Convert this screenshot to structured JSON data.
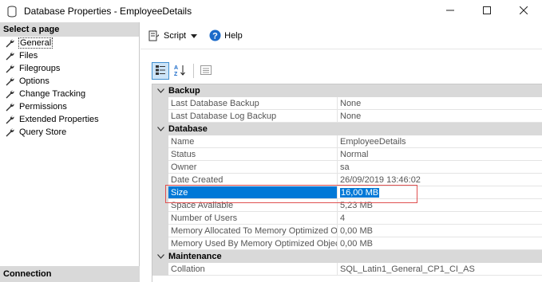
{
  "window": {
    "title": "Database Properties - EmployeeDetails",
    "icons": {
      "app": "database-icon",
      "minimize": "minimize-icon",
      "maximize": "maximize-icon",
      "close": "close-icon"
    }
  },
  "sidebar": {
    "header": "Select a page",
    "items": [
      {
        "label": "General"
      },
      {
        "label": "Files"
      },
      {
        "label": "Filegroups"
      },
      {
        "label": "Options"
      },
      {
        "label": "Change Tracking"
      },
      {
        "label": "Permissions"
      },
      {
        "label": "Extended Properties"
      },
      {
        "label": "Query Store"
      }
    ],
    "selected_index": 0,
    "connection_header": "Connection"
  },
  "toolbar": {
    "script_label": "Script",
    "help_label": "Help"
  },
  "grid_tools": {
    "categorized_icon": "categorized-icon",
    "alphabetical_icon": "sort-az-icon",
    "property_pages_icon": "property-pages-icon"
  },
  "properties": {
    "categories": [
      {
        "name": "Backup",
        "rows": [
          {
            "name": "Last Database Backup",
            "value": "None"
          },
          {
            "name": "Last Database Log Backup",
            "value": "None"
          }
        ]
      },
      {
        "name": "Database",
        "rows": [
          {
            "name": "Name",
            "value": "EmployeeDetails"
          },
          {
            "name": "Status",
            "value": "Normal"
          },
          {
            "name": "Owner",
            "value": "sa"
          },
          {
            "name": "Date Created",
            "value": "26/09/2019 13:46:02"
          },
          {
            "name": "Size",
            "value": "16,00 MB"
          },
          {
            "name": "Space Available",
            "value": "5,23 MB"
          },
          {
            "name": "Number of Users",
            "value": "4"
          },
          {
            "name": "Memory Allocated To Memory Optimized Obj",
            "value": "0,00 MB"
          },
          {
            "name": "Memory Used By Memory Optimized Objects",
            "value": "0,00 MB"
          }
        ]
      },
      {
        "name": "Maintenance",
        "rows": [
          {
            "name": "Collation",
            "value": "SQL_Latin1_General_CP1_CI_AS"
          }
        ]
      }
    ],
    "selected_row": "Size"
  },
  "colors": {
    "selection": "#0078d7",
    "category_bg": "#d9d9d9",
    "highlight_border": "#e05050"
  }
}
